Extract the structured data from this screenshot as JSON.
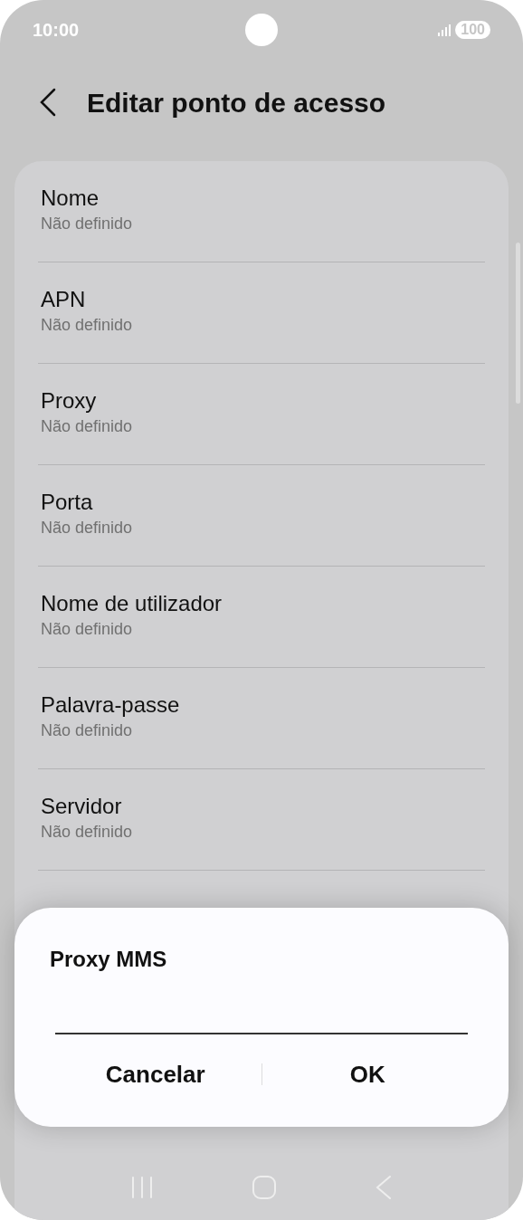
{
  "status_bar": {
    "time": "10:00",
    "battery": "100"
  },
  "header": {
    "title": "Editar ponto de acesso"
  },
  "settings": [
    {
      "title": "Nome",
      "value": "Não definido"
    },
    {
      "title": "APN",
      "value": "Não definido"
    },
    {
      "title": "Proxy",
      "value": "Não definido"
    },
    {
      "title": "Porta",
      "value": "Não definido"
    },
    {
      "title": "Nome de utilizador",
      "value": "Não definido"
    },
    {
      "title": "Palavra-passe",
      "value": "Não definido"
    },
    {
      "title": "Servidor",
      "value": "Não definido"
    }
  ],
  "dialog": {
    "title": "Proxy MMS",
    "buttons": [
      "Cancelar",
      "OK"
    ]
  }
}
